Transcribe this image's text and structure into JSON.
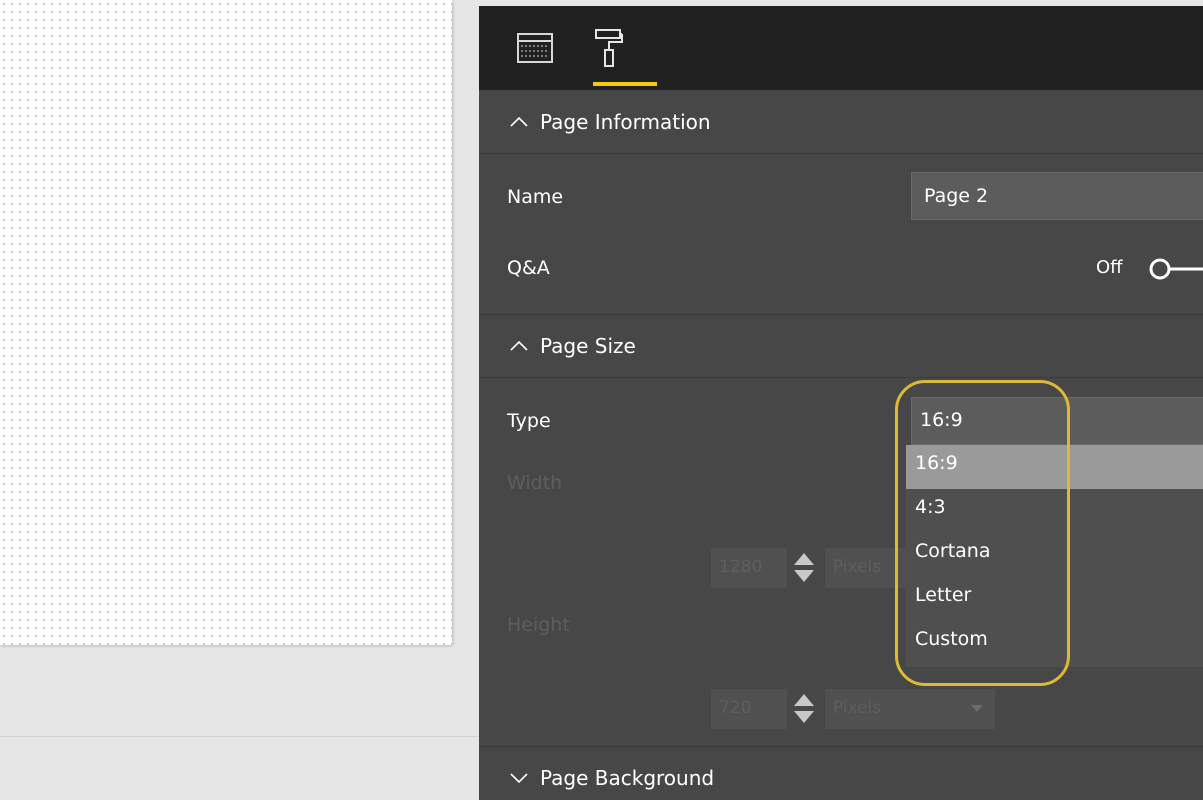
{
  "pane": {
    "tabs": [
      {
        "name": "fields",
        "icon": "table-icon"
      },
      {
        "name": "format",
        "icon": "paint-roller-icon",
        "active": true
      }
    ],
    "accent_color": "#f2c811",
    "highlight_color": "#ddb93a"
  },
  "page_information": {
    "header": "Page Information",
    "name_label": "Name",
    "name_value": "Page 2",
    "qa_label": "Q&A",
    "qa_state": "Off"
  },
  "page_size": {
    "header": "Page Size",
    "type_label": "Type",
    "type_value": "16:9",
    "options": [
      "16:9",
      "4:3",
      "Cortana",
      "Letter",
      "Custom"
    ],
    "selected_option": "16:9",
    "width_label": "Width",
    "width_value": "1280",
    "width_unit": "Pixels",
    "height_label": "Height",
    "height_value": "720",
    "height_unit": "Pixels"
  },
  "page_background": {
    "header": "Page Background"
  }
}
